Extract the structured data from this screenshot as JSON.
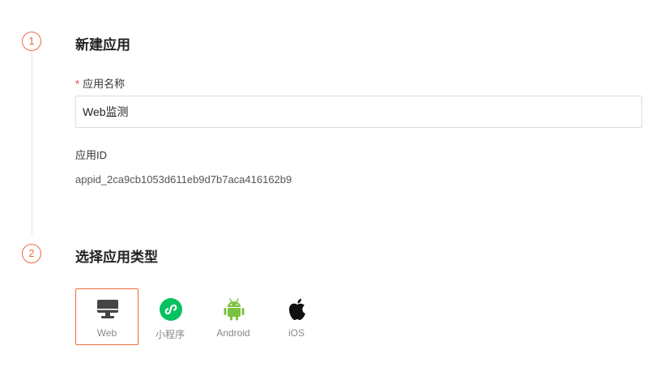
{
  "steps": [
    {
      "number": "1",
      "title": "新建应用"
    },
    {
      "number": "2",
      "title": "选择应用类型"
    }
  ],
  "form": {
    "required_mark": "*",
    "app_name_label": "应用名称",
    "app_name_value": "Web监测",
    "app_id_label": "应用ID",
    "app_id_value": "appid_2ca9cb1053d611eb9d7b7aca416162b9"
  },
  "app_types": {
    "selected": "Web",
    "options": [
      {
        "label": "Web",
        "icon": "monitor-icon",
        "color": "#444444"
      },
      {
        "label": "小程序",
        "icon": "mini-program-icon",
        "color": "#07c160"
      },
      {
        "label": "Android",
        "icon": "android-icon",
        "color": "#7cc242"
      },
      {
        "label": "iOS",
        "icon": "apple-icon",
        "color": "#111111"
      }
    ]
  },
  "colors": {
    "accent": "#ed6a3c",
    "required": "#e4393c"
  }
}
